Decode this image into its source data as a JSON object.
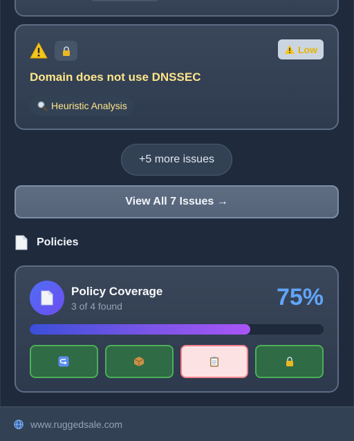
{
  "issue": {
    "severity_label": "Low",
    "title": "Domain does not use DNSSEC",
    "source_label": "Heuristic Analysis",
    "icons": [
      "warning-icon",
      "lock-icon",
      "magnifier-icon"
    ]
  },
  "more_issues_label": "+5 more issues",
  "view_all_label": "View All 7 Issues →",
  "policies": {
    "section_title": "Policies",
    "card_title": "Policy Coverage",
    "found_text": "3 of 4 found",
    "percent_text": "75%",
    "coverage": 0.75,
    "items": [
      {
        "icon": "return-arrow-icon",
        "status": "found"
      },
      {
        "icon": "package-icon",
        "status": "found"
      },
      {
        "icon": "clipboard-icon",
        "status": "missing"
      },
      {
        "icon": "lock-icon",
        "status": "found"
      }
    ]
  },
  "footer": {
    "domain": "www.ruggedsale.com",
    "icon": "globe-icon"
  },
  "colors": {
    "low_severity": "#e6b300",
    "title_yellow": "#fde68a",
    "percent_blue": "#60a5fa",
    "found_green": "#2f6b44",
    "missing_pink": "#fde2e4"
  }
}
